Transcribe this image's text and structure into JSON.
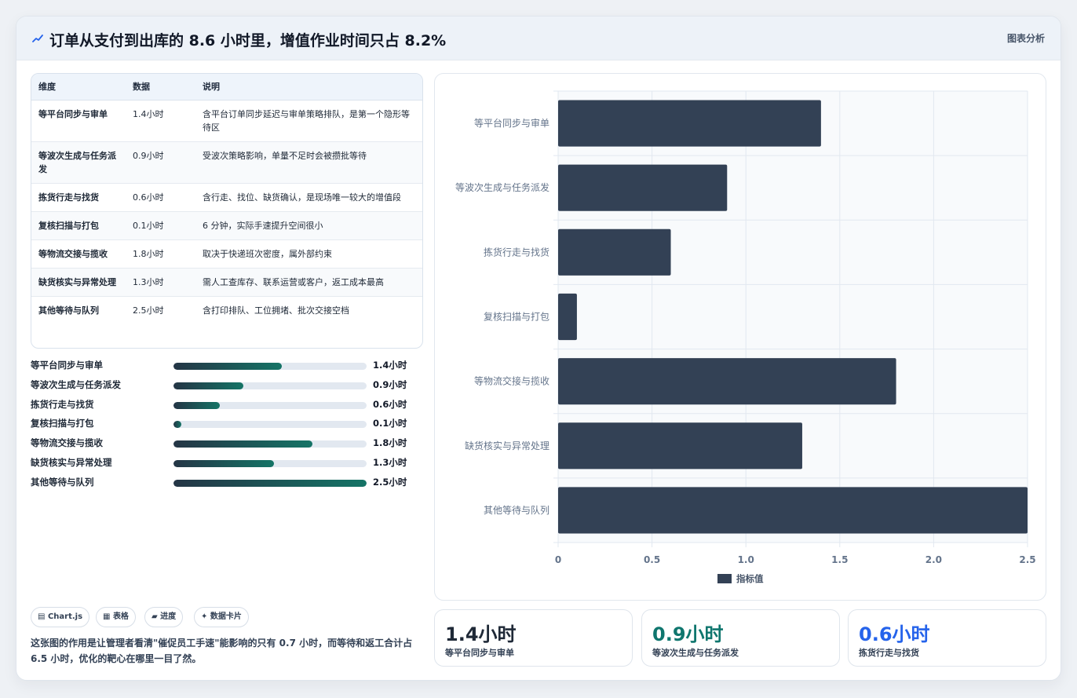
{
  "header": {
    "title": "订单从支付到出库的 8.6 小时里，增值作业时间只占 8.2%",
    "tag": "图表分析"
  },
  "table": {
    "headers": [
      "维度",
      "数据",
      "说明"
    ],
    "rows": [
      {
        "name": "等平台同步与审单",
        "value": "1.4小时",
        "desc": "含平台订单同步延迟与审单策略排队，是第一个隐形等待区"
      },
      {
        "name": "等波次生成与任务派发",
        "value": "0.9小时",
        "desc": "受波次策略影响，单量不足时会被攒批等待"
      },
      {
        "name": "拣货行走与找货",
        "value": "0.6小时",
        "desc": "含行走、找位、缺货确认，是现场唯一较大的增值段"
      },
      {
        "name": "复核扫描与打包",
        "value": "0.1小时",
        "desc": "6 分钟，实际手速提升空间很小"
      },
      {
        "name": "等物流交接与揽收",
        "value": "1.8小时",
        "desc": "取决于快递班次密度，属外部约束"
      },
      {
        "name": "缺货核实与异常处理",
        "value": "1.3小时",
        "desc": "需人工查库存、联系运营或客户，返工成本最高"
      },
      {
        "name": "其他等待与队列",
        "value": "2.5小时",
        "desc": "含打印排队、工位拥堵、批次交接空档"
      }
    ]
  },
  "progress": [
    {
      "label": "等平台同步与审单",
      "value": 1.4,
      "text": "1.4小时"
    },
    {
      "label": "等波次生成与任务派发",
      "value": 0.9,
      "text": "0.9小时"
    },
    {
      "label": "拣货行走与找货",
      "value": 0.6,
      "text": "0.6小时"
    },
    {
      "label": "复核扫描与打包",
      "value": 0.1,
      "text": "0.1小时"
    },
    {
      "label": "等物流交接与揽收",
      "value": 1.8,
      "text": "1.8小时"
    },
    {
      "label": "缺货核实与异常处理",
      "value": 1.3,
      "text": "1.3小时"
    },
    {
      "label": "其他等待与队列",
      "value": 2.5,
      "text": "2.5小时"
    }
  ],
  "chips": [
    "Chart.js",
    "表格",
    "进度",
    "数据卡片"
  ],
  "note": "这张图的作用是让管理者看清\"催促员工手速\"能影响的只有 0.7 小时，而等待和返工合计占 6.5 小时，优化的靶心在哪里一目了然。",
  "stats": [
    {
      "value": "1.4小时",
      "label": "等平台同步与审单",
      "color": "#1f2937"
    },
    {
      "value": "0.9小时",
      "label": "等波次生成与任务派发",
      "color": "#0f766e"
    },
    {
      "value": "0.6小时",
      "label": "拣货行走与找货",
      "color": "#2563eb"
    }
  ],
  "colors": {
    "bar": "#334155",
    "accent": "#157466"
  },
  "chart_data": {
    "type": "bar",
    "orientation": "horizontal",
    "categories": [
      "等平台同步与审单",
      "等波次生成与任务派发",
      "拣货行走与找货",
      "复核扫描与打包",
      "等物流交接与揽收",
      "缺货核实与异常处理",
      "其他等待与队列"
    ],
    "series": [
      {
        "name": "指标值",
        "values": [
          1.4,
          0.9,
          0.6,
          0.1,
          1.8,
          1.3,
          2.5
        ]
      }
    ],
    "xlim": [
      0,
      2.5
    ],
    "xticks": [
      "0",
      "0.5",
      "1.0",
      "1.5",
      "2.0",
      "2.5"
    ],
    "grid": true,
    "legend": "bottom"
  }
}
